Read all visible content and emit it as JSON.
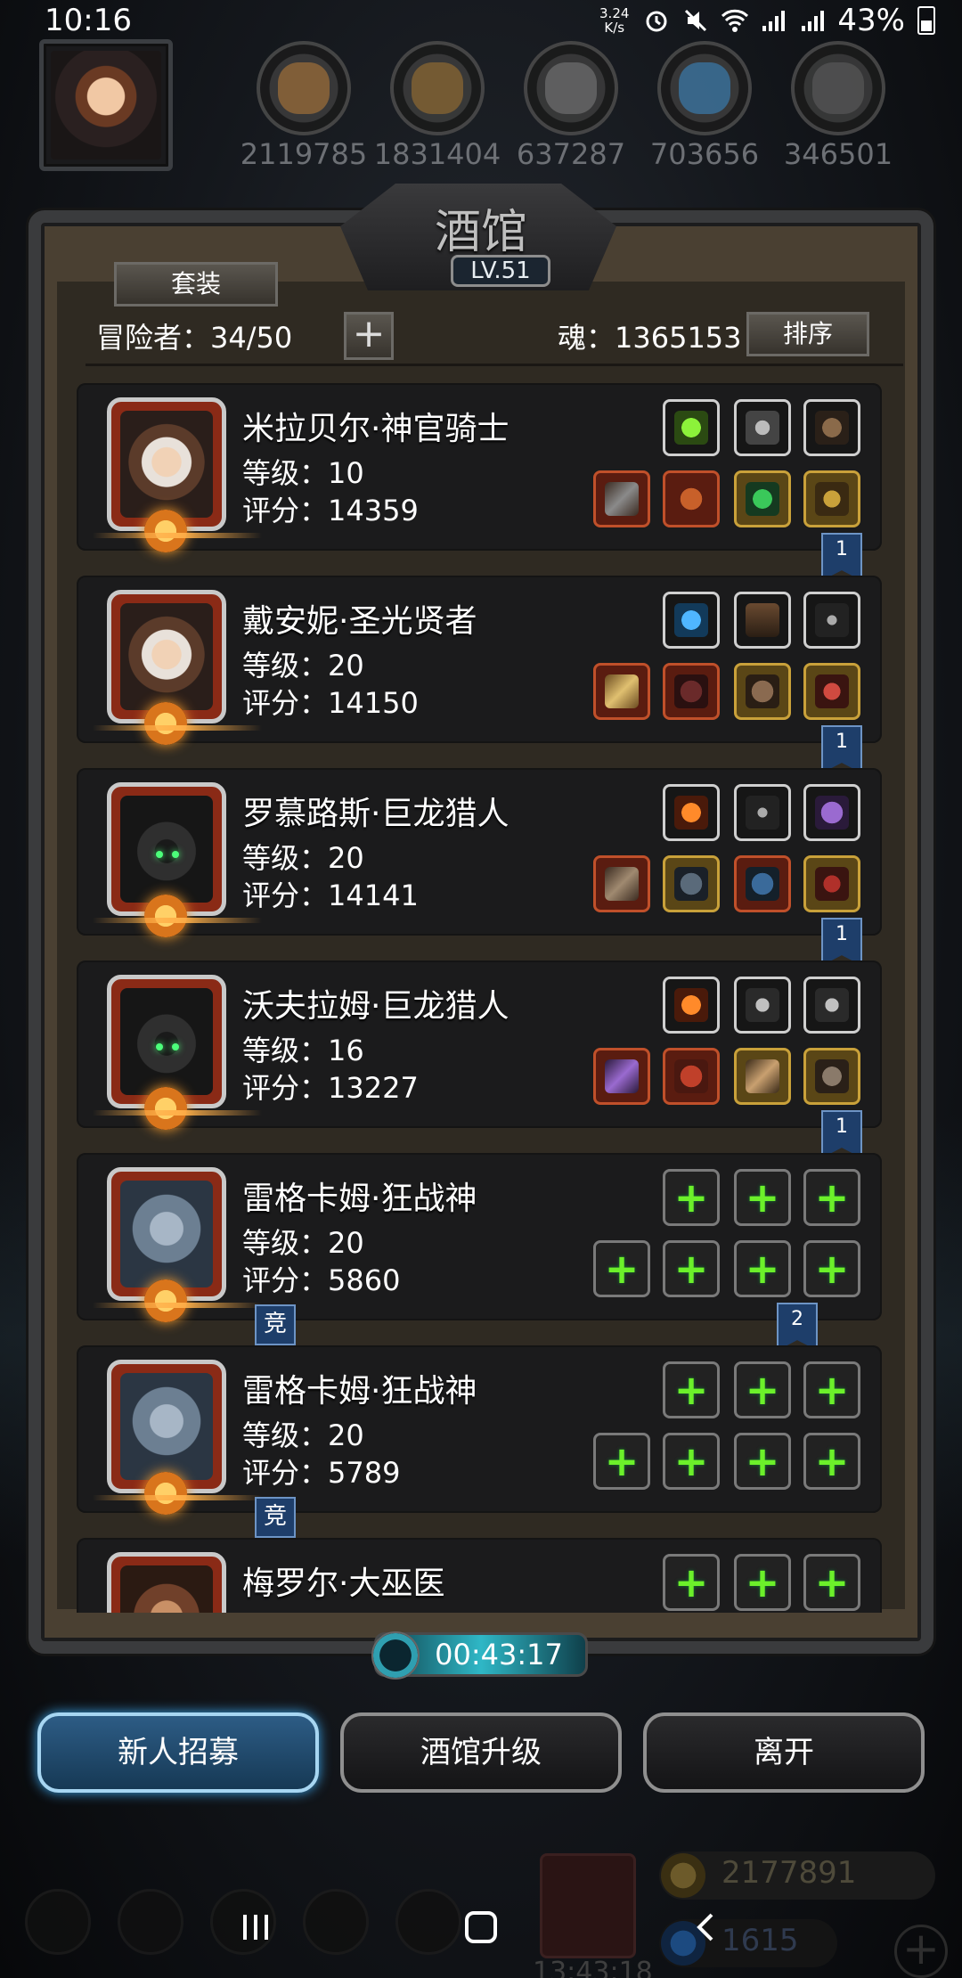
{
  "status": {
    "time": "10:16",
    "speed_top": "3.24",
    "speed_bottom": "K/s",
    "battery": "43%"
  },
  "resources": [
    {
      "value": "2119785",
      "color": "#d08a3c"
    },
    {
      "value": "1831404",
      "color": "#b68232"
    },
    {
      "value": "637287",
      "color": "#8a8a8a"
    },
    {
      "value": "703656",
      "color": "#3f9be0"
    },
    {
      "value": "346501",
      "color": "#6a6a6a"
    }
  ],
  "tavern": {
    "title": "酒馆",
    "level": "LV.51",
    "set_label": "套装",
    "adventurers_label": "冒险者：34/50",
    "add_label": "+",
    "soul_label": "魂：1365153",
    "sort_label": "排序"
  },
  "heroes": [
    {
      "name": "米拉贝尔·神官骑士",
      "level": "等级：10",
      "score": "评分：14359",
      "portrait": "girl",
      "badge": "1",
      "badge_left": ""
    },
    {
      "name": "戴安妮·圣光贤者",
      "level": "等级：20",
      "score": "评分：14150",
      "portrait": "girl",
      "badge": "1",
      "badge_left": ""
    },
    {
      "name": "罗慕路斯·巨龙猎人",
      "level": "等级：20",
      "score": "评分：14141",
      "portrait": "hood",
      "badge": "1",
      "badge_left": ""
    },
    {
      "name": "沃夫拉姆·巨龙猎人",
      "level": "等级：16",
      "score": "评分：13227",
      "portrait": "hood",
      "badge": "1",
      "badge_left": ""
    },
    {
      "name": "雷格卡姆·狂战神",
      "level": "等级：20",
      "score": "评分：5860",
      "portrait": "zeus",
      "badge": "2",
      "badge_left": "竞"
    },
    {
      "name": "雷格卡姆·狂战神",
      "level": "等级：20",
      "score": "评分：5789",
      "portrait": "zeus",
      "badge": "",
      "badge_left": "竞"
    },
    {
      "name": "梅罗尔·大巫医",
      "level": "",
      "score": "",
      "portrait": "shaman",
      "badge": "",
      "badge_left": ""
    }
  ],
  "timer": "00:43:17",
  "buttons": {
    "recruit": "新人招募",
    "upgrade": "酒馆升级",
    "leave": "离开"
  },
  "footer": {
    "gold": "2177891",
    "gem": "1615",
    "chest_time": "13:43:18"
  }
}
